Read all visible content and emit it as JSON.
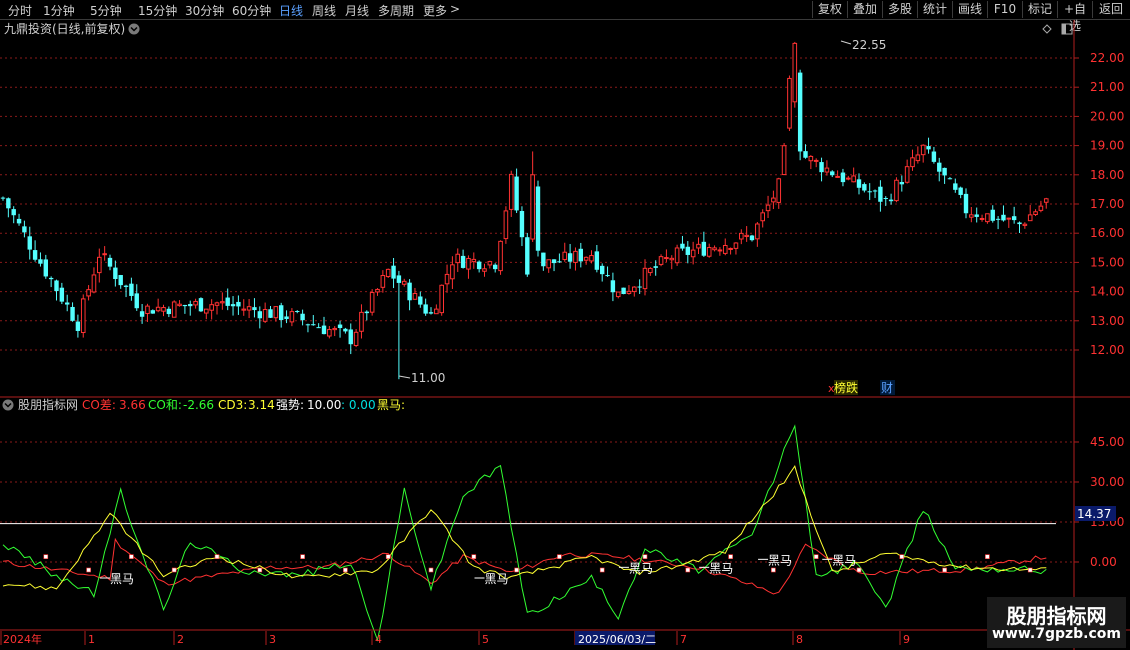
{
  "toolbar": {
    "periods": [
      "分时",
      "1分钟",
      "5分钟",
      "15分钟",
      "30分钟",
      "60分钟",
      "日线",
      "周线",
      "月线",
      "多周期",
      "更多"
    ],
    "active_period": "日线",
    "more_arrow": ">",
    "right_buttons": [
      "复权",
      "叠加",
      "多股",
      "统计",
      "画线",
      "F10",
      "标记",
      "+自选",
      "返回"
    ]
  },
  "main_chart": {
    "title": "九鼎投资(日线,前复权)",
    "dropdown_icon": "chevron-down-circle-icon",
    "diamond_icon": "diamond-icon",
    "settings_icon": "window-icon",
    "high_label": "22.55",
    "low_label": "11.00",
    "y_ticks": [
      "22.00",
      "21.00",
      "20.00",
      "19.00",
      "18.00",
      "17.00",
      "16.00",
      "15.00",
      "14.00",
      "13.00",
      "12.00"
    ],
    "y_values": [
      22,
      21,
      20,
      19,
      18,
      17,
      16,
      15,
      14,
      13,
      12
    ],
    "marker_rank": "榜跌",
    "marker_rank_prefix": "x",
    "marker_fin": "财",
    "colors": {
      "up": "#ff3232",
      "down": "#54ffff",
      "grid": "#8a1a1a"
    }
  },
  "indicator": {
    "name": "股朋指标网",
    "co_diff_label": "CO差:",
    "co_diff_value": "3.66",
    "co_sum_label": "CO和:",
    "co_sum_value": "-2.66",
    "cd3_label": "CD3:",
    "cd3_value": "3.14",
    "strength_label": "强势:",
    "strength_value": "10.00",
    "extra_value": ": 0.00",
    "heima_label": "黑马:",
    "y_ticks": [
      "45.00",
      "30.00",
      "15.00",
      "0.00"
    ],
    "y_values": [
      45,
      30,
      15,
      0
    ],
    "highlight_value": "14.37",
    "signal_label": "黑马",
    "colors": {
      "co_diff": "#ff3232",
      "co_sum": "#32ff32",
      "cd3": "#ffff32",
      "strength": "#ffffff",
      "extra": "#00e0e0"
    }
  },
  "timeline": {
    "year_label": "2024年",
    "months": [
      "1",
      "2",
      "3",
      "4",
      "5",
      "6",
      "7",
      "8",
      "9"
    ],
    "cursor_date": "2025/06/03/二"
  },
  "watermark": {
    "title": "股朋指标网",
    "url": "www.7gpzb.com"
  },
  "chart_data": {
    "type": "candlestick",
    "price_axis": {
      "ylim": [
        11.0,
        22.8
      ],
      "ticks": [
        22,
        21,
        20,
        19,
        18,
        17,
        16,
        15,
        14,
        13,
        12
      ]
    },
    "price_max_label": 22.55,
    "price_min_label": 11.0,
    "price_path_keypoints": [
      {
        "pos": 0,
        "close": 17.2
      },
      {
        "pos": 6,
        "close": 15.3
      },
      {
        "pos": 14,
        "close": 12.9
      },
      {
        "pos": 18,
        "close": 15.3
      },
      {
        "pos": 26,
        "close": 13.4
      },
      {
        "pos": 40,
        "close": 13.6
      },
      {
        "pos": 55,
        "close": 13.1
      },
      {
        "pos": 65,
        "close": 12.4
      },
      {
        "pos": 72,
        "close": 14.7
      },
      {
        "pos": 80,
        "close": 13.2
      },
      {
        "pos": 84,
        "close": 15.1
      },
      {
        "pos": 92,
        "close": 15.0
      },
      {
        "pos": 95,
        "close": 17.8
      },
      {
        "pos": 98,
        "close": 14.8
      },
      {
        "pos": 110,
        "close": 15.3
      },
      {
        "pos": 115,
        "close": 13.9
      },
      {
        "pos": 125,
        "close": 15.2
      },
      {
        "pos": 140,
        "close": 15.9
      },
      {
        "pos": 145,
        "close": 17.6
      },
      {
        "pos": 148,
        "close": 21.0
      },
      {
        "pos": 150,
        "close": 18.6
      },
      {
        "pos": 165,
        "close": 17.1
      },
      {
        "pos": 172,
        "close": 18.9
      },
      {
        "pos": 180,
        "close": 16.8
      },
      {
        "pos": 190,
        "close": 16.3
      },
      {
        "pos": 195,
        "close": 17.1
      }
    ],
    "indicator_axis": {
      "ylim": [
        -22,
        55
      ],
      "ticks": [
        45,
        30,
        15,
        0
      ]
    },
    "indicator_reference_line": 14.37,
    "series": [
      {
        "name": "CO差",
        "keypoints": [
          [
            0,
            0
          ],
          [
            10,
            -3
          ],
          [
            20,
            -6
          ],
          [
            21,
            8
          ],
          [
            30,
            -8
          ],
          [
            50,
            -2
          ],
          [
            60,
            -2
          ],
          [
            72,
            3
          ],
          [
            80,
            -8
          ],
          [
            86,
            2
          ],
          [
            95,
            -4
          ],
          [
            105,
            3
          ],
          [
            115,
            2
          ],
          [
            130,
            -2
          ],
          [
            145,
            -12
          ],
          [
            150,
            6
          ],
          [
            160,
            -4
          ],
          [
            180,
            -3
          ],
          [
            195,
            2
          ]
        ]
      },
      {
        "name": "CO和",
        "keypoints": [
          [
            0,
            7
          ],
          [
            10,
            -5
          ],
          [
            17,
            -12
          ],
          [
            22,
            26
          ],
          [
            30,
            -18
          ],
          [
            35,
            8
          ],
          [
            45,
            -3
          ],
          [
            55,
            -5
          ],
          [
            65,
            0
          ],
          [
            70,
            -30
          ],
          [
            75,
            27
          ],
          [
            80,
            -10
          ],
          [
            86,
            25
          ],
          [
            93,
            36
          ],
          [
            98,
            -20
          ],
          [
            110,
            -6
          ],
          [
            115,
            -20
          ],
          [
            120,
            5
          ],
          [
            130,
            -3
          ],
          [
            140,
            10
          ],
          [
            148,
            52
          ],
          [
            152,
            -6
          ],
          [
            160,
            0
          ],
          [
            165,
            -18
          ],
          [
            172,
            20
          ],
          [
            178,
            -2
          ],
          [
            195,
            -3
          ]
        ]
      },
      {
        "name": "CD3",
        "keypoints": [
          [
            0,
            -8
          ],
          [
            10,
            -10
          ],
          [
            20,
            18
          ],
          [
            30,
            -5
          ],
          [
            40,
            2
          ],
          [
            55,
            -6
          ],
          [
            70,
            -3
          ],
          [
            80,
            20
          ],
          [
            88,
            -2
          ],
          [
            95,
            -6
          ],
          [
            110,
            2
          ],
          [
            118,
            -4
          ],
          [
            125,
            -2
          ],
          [
            135,
            4
          ],
          [
            148,
            35
          ],
          [
            155,
            -4
          ],
          [
            165,
            3
          ],
          [
            180,
            -2
          ],
          [
            195,
            -3
          ]
        ]
      }
    ],
    "signals": [
      "黑马",
      "黑马",
      "黑马",
      "黑马",
      "黑马",
      "黑马"
    ]
  }
}
